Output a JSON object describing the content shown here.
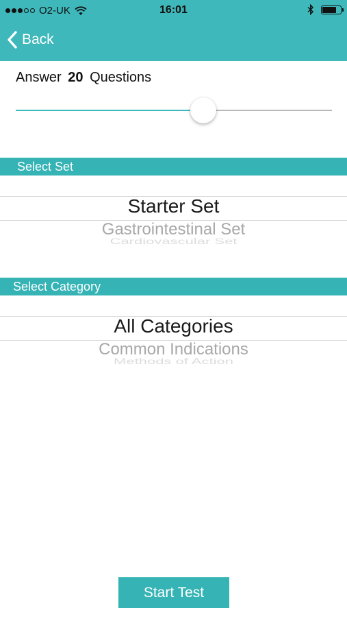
{
  "status_bar": {
    "carrier": "O2-UK",
    "signal_bars_filled": 3,
    "signal_bars_total": 5,
    "time": "16:01",
    "battery_level": 0.7
  },
  "nav": {
    "back_label": "Back"
  },
  "question_count": {
    "prefix": "Answer",
    "value": "20",
    "suffix": "Questions",
    "slider_fraction": 0.593
  },
  "select_set": {
    "header": "Select Set",
    "selected": "Starter Set",
    "next_1": "Gastrointestinal Set",
    "next_2": "Cardiovascular Set"
  },
  "select_category": {
    "header": "Select Category",
    "selected": "All Categories",
    "next_1": "Common Indications",
    "next_2": "Methods of Action"
  },
  "actions": {
    "start_label": "Start Test"
  },
  "colors": {
    "accent": "#3fb8bb",
    "section_header": "#35b3b5"
  },
  "icons": [
    "signal-icon",
    "wifi-icon",
    "bluetooth-icon",
    "battery-icon",
    "chevron-left-icon"
  ]
}
